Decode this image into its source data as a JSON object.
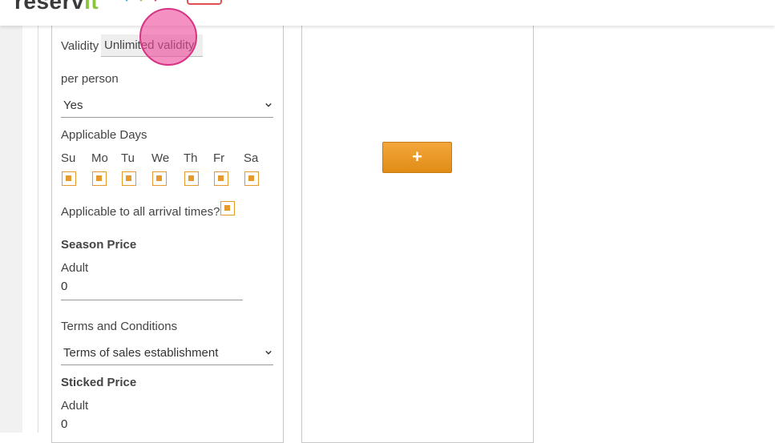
{
  "header": {
    "logo_text": "reserv",
    "logo_accent": "it"
  },
  "form": {
    "validity_label": "Validity",
    "validity_value": "Unlimited validity",
    "per_person_label": "per person",
    "per_person_value": "Yes",
    "applicable_days_label": "Applicable Days",
    "days": [
      "Su",
      "Mo",
      "Tu",
      "We",
      "Th",
      "Fr",
      "Sa"
    ],
    "arrival_times_label": "Applicable to all arrival times?",
    "season_price_heading": "Season Price",
    "season_adult_label": "Adult",
    "season_adult_value": "0",
    "terms_label": "Terms and Conditions",
    "terms_value": "Terms of sales establishment",
    "sticked_price_heading": "Sticked Price",
    "sticked_adult_label": "Adult",
    "sticked_adult_value": "0"
  },
  "add_button": {
    "label": "+"
  },
  "colors": {
    "accent_orange": "#e69a2e",
    "logo_green": "#8cc43f",
    "cursor_pink": "#ec4899"
  }
}
